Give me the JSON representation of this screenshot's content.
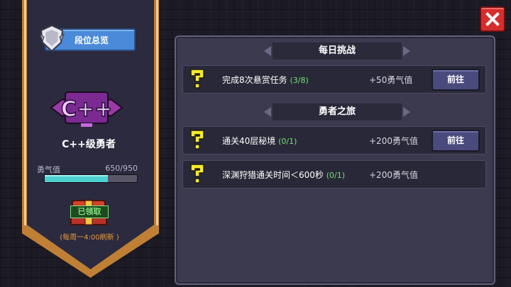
{
  "sidebar": {
    "rank_overview_label": "段位总览",
    "rank_badge_text": "C++",
    "rank_title": "C++级勇者",
    "bravery_label": "勇气值",
    "bravery_value": "650/950",
    "bravery_progress": 0.684,
    "claimed_label": "已领取",
    "refresh_note": "(每周一4:00刷新 )"
  },
  "daily": {
    "header": "每日挑战",
    "tasks": [
      {
        "title": "完成8次悬赏任务",
        "progress": "(3/8)",
        "reward": "+50勇气值",
        "action": "前往"
      }
    ]
  },
  "journey": {
    "header": "勇者之旅",
    "tasks": [
      {
        "title": "通关40层秘境",
        "progress": "(0/1)",
        "reward": "+200勇气值",
        "action": "前往"
      },
      {
        "title": "深渊狩猎通关时间＜600秒",
        "progress": "(0/1)",
        "reward": "+200勇气值"
      }
    ]
  },
  "icons": {
    "close": "close-icon",
    "task": "question-mark-icon",
    "rank_overview": "shield-icon",
    "badge": "rank-badge-icon",
    "chest": "chest-icon"
  },
  "colors": {
    "banner_gold": "#bf7f35",
    "progress_cyan": "#4ed0d0",
    "progress_green": "#70e070",
    "go_button": "#4a4a7c",
    "close_red": "#d42e2e",
    "question_yellow": "#f6ea2c"
  }
}
